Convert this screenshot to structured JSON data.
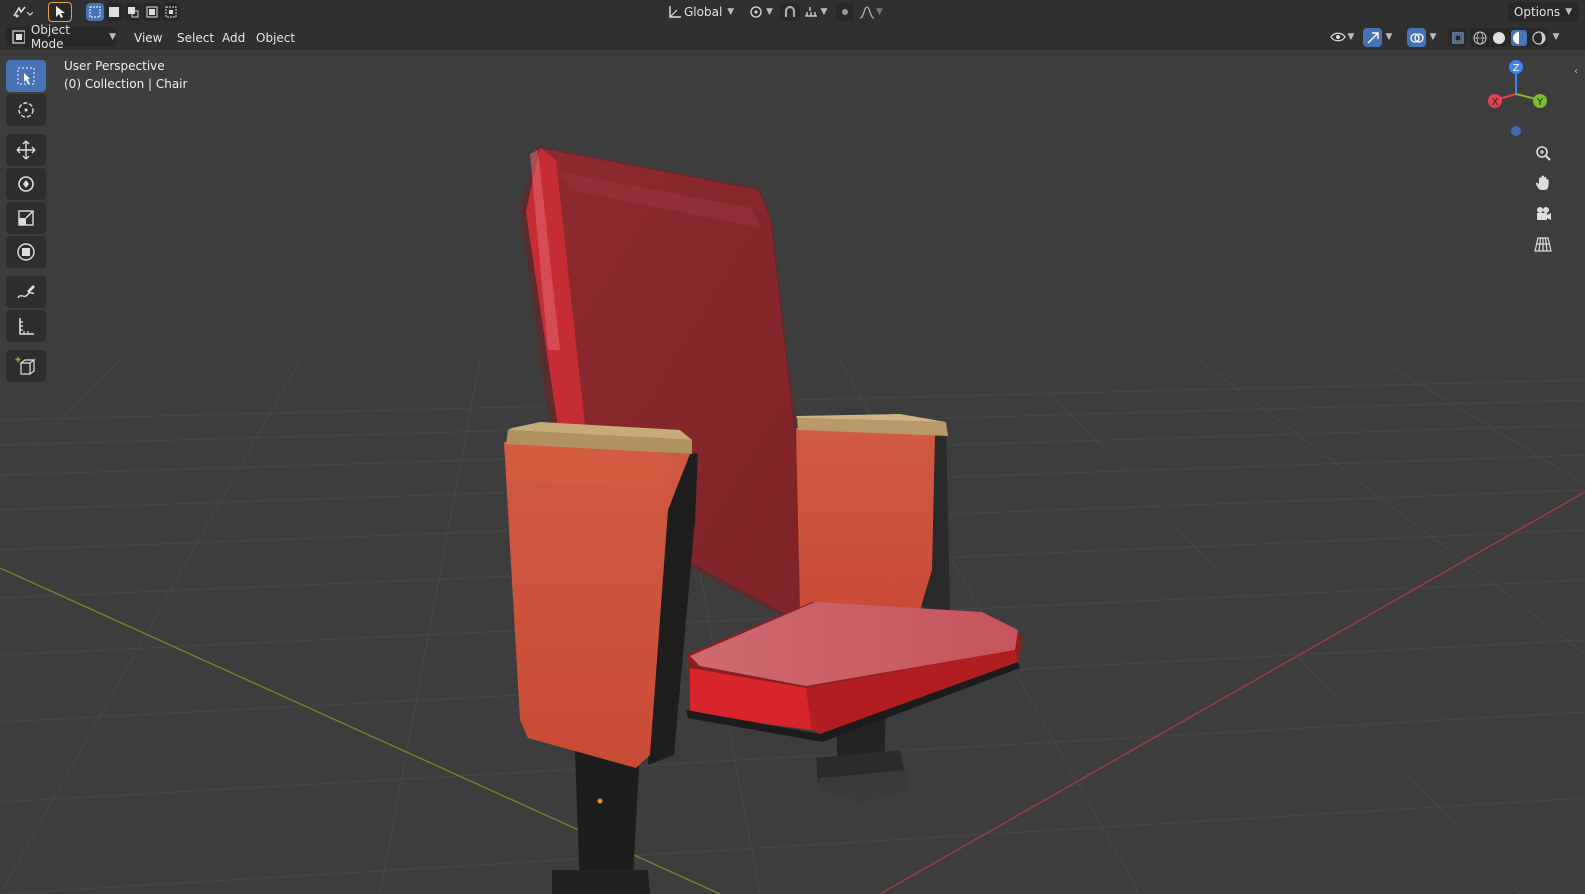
{
  "tool_header": {
    "transform_orientation": "Global",
    "options_label": "Options"
  },
  "view_header": {
    "mode": "Object Mode",
    "menus": [
      "View",
      "Select",
      "Add",
      "Object"
    ]
  },
  "viewport": {
    "perspective_label": "User Perspective",
    "collection_label": "(0) Collection | Chair"
  },
  "gizmo": {
    "x_label": "X",
    "y_label": "Y",
    "z_label": "Z"
  },
  "tools": [
    {
      "name": "select-box-tool",
      "icon": "select-box-icon",
      "active": true
    },
    {
      "name": "cursor-tool",
      "icon": "cursor-icon",
      "active": false
    },
    {
      "name": "move-tool",
      "icon": "move-icon",
      "active": false
    },
    {
      "name": "rotate-tool",
      "icon": "rotate-icon",
      "active": false
    },
    {
      "name": "scale-tool",
      "icon": "scale-icon",
      "active": false
    },
    {
      "name": "transform-tool",
      "icon": "transform-icon",
      "active": false
    },
    {
      "name": "annotate-tool",
      "icon": "annotate-icon",
      "active": false
    },
    {
      "name": "measure-tool",
      "icon": "measure-icon",
      "active": false
    },
    {
      "name": "add-cube-tool",
      "icon": "add-cube-icon",
      "active": false
    }
  ],
  "colors": {
    "accent": "#4772b3",
    "x_axis": "#e8404f",
    "y_axis": "#7cbd2b",
    "z_axis": "#3b84f2",
    "chair_red": "#c83a3a",
    "chair_arm": "#d45a40",
    "arm_top": "#b89a6a",
    "frame": "#2a2a2a"
  }
}
